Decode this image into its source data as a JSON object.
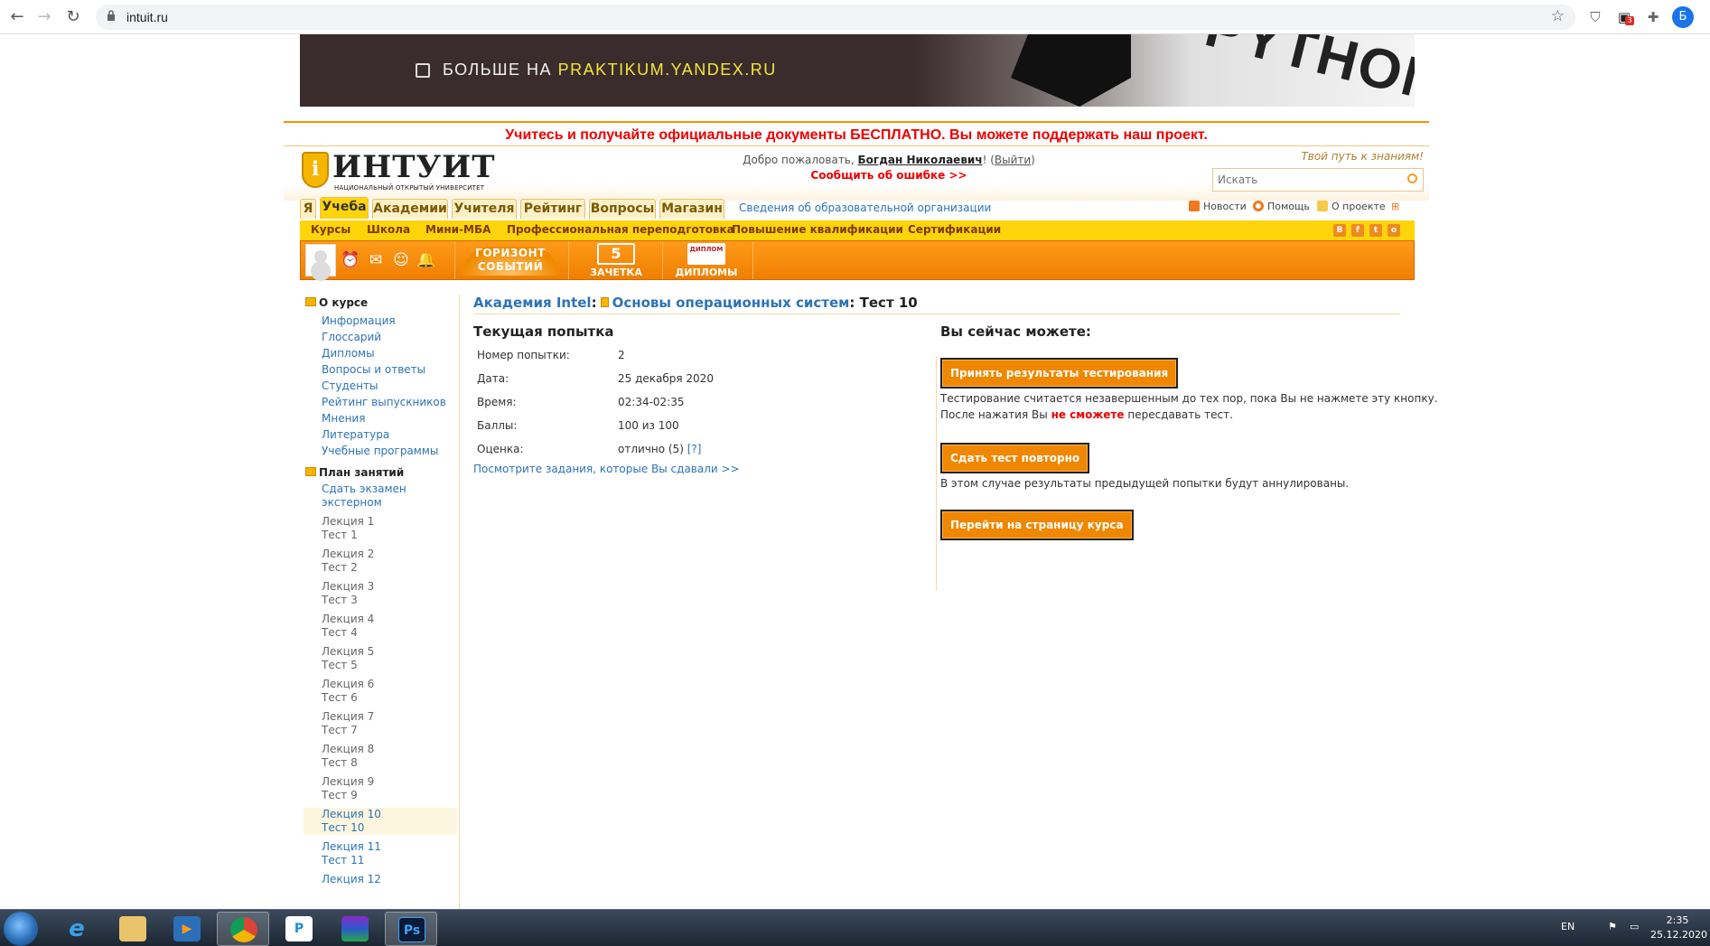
{
  "browser": {
    "url": "intuit.ru",
    "profile_initial": "Б",
    "ext_badge": "3"
  },
  "banner": {
    "text_prefix": "БОЛЬШЕ НА",
    "text_link": "PRAKTIKUM.YANDEX.RU",
    "art_text": "PYTHON"
  },
  "promo": "Учитесь и получайте официальные документы БЕСПЛАТНО. Вы можете поддержать наш проект.",
  "header": {
    "logo_name": "ИНТУИТ",
    "logo_sub": "НАЦИОНАЛЬНЫЙ ОТКРЫТЫЙ УНИВЕРСИТЕТ",
    "welcome_prefix": "Добро пожаловать,",
    "user_name": "Богдан Николаевич",
    "exclaim": "!",
    "logout": "Выйти",
    "report_error": "Сообщить об ошибке >>",
    "slogan": "Твой путь к знаниям!",
    "search_placeholder": "Искать"
  },
  "main_tabs": [
    "Я",
    "Учеба",
    "Академии",
    "Учителя",
    "Рейтинг",
    "Вопросы",
    "Магазин"
  ],
  "active_tab": "Учеба",
  "org_link": "Сведения об образовательной организации",
  "util_links": [
    "Новости",
    "Помощь",
    "О проекте"
  ],
  "sub_nav": [
    "Курсы",
    "Школа",
    "Мини-МБА",
    "Профессиональная переподготовка",
    "Повышение квалификации",
    "Сертификации"
  ],
  "social": [
    "В",
    "f",
    "t",
    "o"
  ],
  "toolbar": {
    "horizon": [
      "ГОРИЗОНТ",
      "СОБЫТИЙ"
    ],
    "gradebook": "ЗАЧЕТКА",
    "gradebook_num": "5",
    "diplomas": "ДИПЛОМЫ",
    "diploma_pic": "ДИПЛОМ"
  },
  "sidebar": {
    "about_title": "О курсе",
    "about_items": [
      "Информация",
      "Глоссарий",
      "Дипломы",
      "Вопросы и ответы",
      "Студенты",
      "Рейтинг выпускников",
      "Мнения",
      "Литература",
      "Учебные программы"
    ],
    "plan_title": "План занятий",
    "exam": [
      "Сдать экзамен",
      "экстерном"
    ],
    "lectures": [
      {
        "lecture": "Лекция 1",
        "test": "Тест 1"
      },
      {
        "lecture": "Лекция 2",
        "test": "Тест 2"
      },
      {
        "lecture": "Лекция 3",
        "test": "Тест 3"
      },
      {
        "lecture": "Лекция 4",
        "test": "Тест 4"
      },
      {
        "lecture": "Лекция 5",
        "test": "Тест 5"
      },
      {
        "lecture": "Лекция 6",
        "test": "Тест 6"
      },
      {
        "lecture": "Лекция 7",
        "test": "Тест 7"
      },
      {
        "lecture": "Лекция 8",
        "test": "Тест 8"
      },
      {
        "lecture": "Лекция 9",
        "test": "Тест 9"
      },
      {
        "lecture": "Лекция 10",
        "test": "Тест 10"
      },
      {
        "lecture": "Лекция 11",
        "test": "Тест 11"
      },
      {
        "lecture": "Лекция 12",
        "test": ""
      }
    ]
  },
  "breadcrumb": {
    "academy": "Академия Intel",
    "course": "Основы операционных систем",
    "current": "Тест 10"
  },
  "attempt": {
    "title": "Текущая попытка",
    "rows": [
      {
        "label": "Номер попытки:",
        "value": "2"
      },
      {
        "label": "Дата:",
        "value": "25 декабря 2020"
      },
      {
        "label": "Время:",
        "value": "02:34-02:35"
      },
      {
        "label": "Баллы:",
        "value": "100 из 100"
      },
      {
        "label": "Оценка:",
        "value": "отлично (5)"
      }
    ],
    "help": "[?]",
    "view_tasks": "Посмотрите задания, которые Вы сдавали >>"
  },
  "actions": {
    "title": "Вы сейчас можете:",
    "accept_btn": "Принять результаты тестирования",
    "accept_note_1": "Тестирование считается незавершенным до тех пор, пока Вы не нажмете эту кнопку.",
    "accept_note_2a": "После нажатия Вы",
    "accept_note_2b": "не сможете",
    "accept_note_2c": "пересдавать тест.",
    "retake_btn": "Сдать тест повторно",
    "retake_note": "В этом случае результаты предыдущей попытки будут аннулированы.",
    "course_btn": "Перейти на страницу курса"
  },
  "taskbar": {
    "lang": "EN",
    "time": "2:35",
    "date": "25.12.2020",
    "apps": [
      "ie",
      "explorer",
      "media",
      "chrome",
      "p",
      "winrar",
      "Ps"
    ]
  },
  "colors": {
    "accent_orange": "#f08700",
    "tab_yellow": "#ffd40b",
    "link_blue": "#2d73b8",
    "promo_red": "#e00000"
  }
}
